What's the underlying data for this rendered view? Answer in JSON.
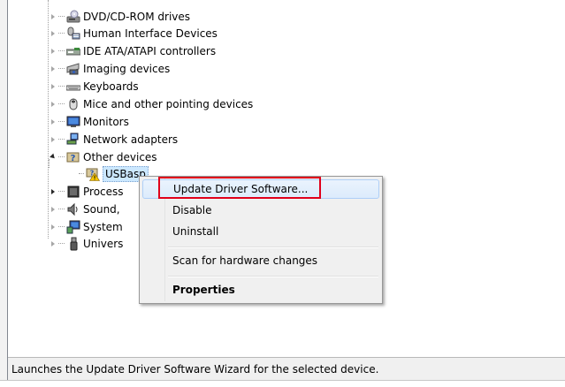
{
  "tree": {
    "items": [
      {
        "label": "DVD/CD-ROM drives",
        "icon": "dvd-drive-icon"
      },
      {
        "label": "Human Interface Devices",
        "icon": "hid-icon"
      },
      {
        "label": "IDE ATA/ATAPI controllers",
        "icon": "ide-controller-icon"
      },
      {
        "label": "Imaging devices",
        "icon": "camera-icon"
      },
      {
        "label": "Keyboards",
        "icon": "keyboard-icon"
      },
      {
        "label": "Mice and other pointing devices",
        "icon": "mouse-icon"
      },
      {
        "label": "Monitors",
        "icon": "monitor-icon"
      },
      {
        "label": "Network adapters",
        "icon": "network-adapter-icon"
      },
      {
        "label": "Other devices",
        "icon": "unknown-device-icon"
      },
      {
        "label": "USBasp",
        "icon": "warning-device-icon"
      },
      {
        "label": "Process",
        "icon": "processor-icon"
      },
      {
        "label": "Sound,",
        "icon": "speaker-icon"
      },
      {
        "label": "System",
        "icon": "system-devices-icon"
      },
      {
        "label": "Univers",
        "icon": "usb-icon"
      }
    ]
  },
  "context_menu": {
    "update_driver": "Update Driver Software...",
    "disable": "Disable",
    "uninstall": "Uninstall",
    "scan": "Scan for hardware changes",
    "properties": "Properties"
  },
  "status_bar": {
    "text": "Launches the Update Driver Software Wizard for the selected device."
  },
  "colors": {
    "highlight_box": "#e0001b",
    "selection": "#cce8ff",
    "menu_background": "#f0f0f0"
  }
}
